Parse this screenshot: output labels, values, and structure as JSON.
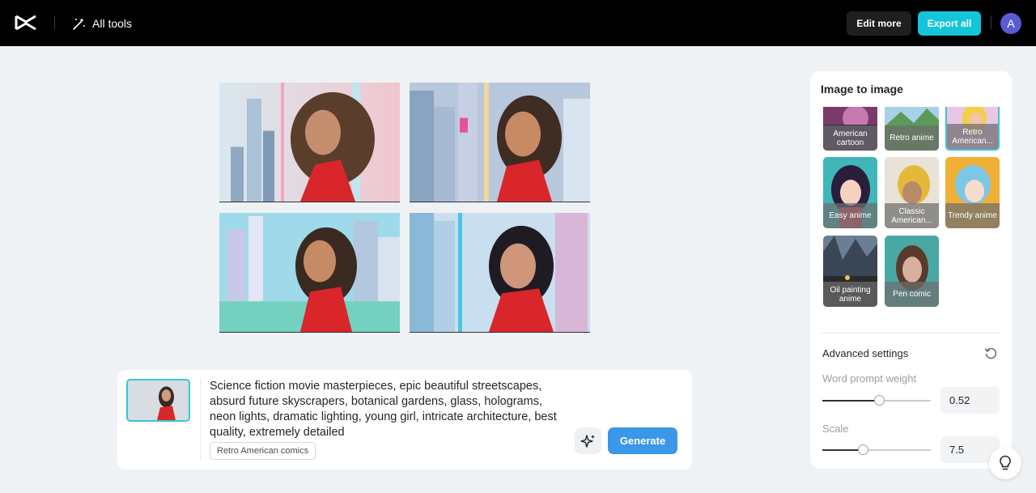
{
  "header": {
    "logo_icon": "capcut-logo-icon",
    "all_tools_label": "All tools",
    "edit_more_label": "Edit more",
    "export_all_label": "Export all",
    "avatar_initial": "A"
  },
  "results": [
    {
      "name": "result-image-1"
    },
    {
      "name": "result-image-2"
    },
    {
      "name": "result-image-3"
    },
    {
      "name": "result-image-4"
    }
  ],
  "prompt": {
    "text": "Science fiction movie masterpieces, epic beautiful streetscapes, absurd future skyscrapers, botanical gardens, glass, holograms, neon lights, dramatic lighting, young girl, intricate architecture, best quality, extremely detailed",
    "style_tag": "Retro American comics",
    "generate_label": "Generate"
  },
  "panel": {
    "title": "Image to image",
    "styles": [
      {
        "label": "American cartoon",
        "selected": false
      },
      {
        "label": "Retro anime",
        "selected": false
      },
      {
        "label": "Retro American...",
        "selected": true
      },
      {
        "label": "Easy anime",
        "selected": false
      },
      {
        "label": "Classic American...",
        "selected": false
      },
      {
        "label": "Trendy anime",
        "selected": false
      },
      {
        "label": "Oil painting anime",
        "selected": false
      },
      {
        "label": "Pen comic",
        "selected": false
      }
    ],
    "advanced_title": "Advanced settings",
    "word_prompt_weight": {
      "label": "Word prompt weight",
      "value": "0.52",
      "fraction": 0.52
    },
    "scale": {
      "label": "Scale",
      "value": "7.5",
      "fraction": 0.37
    }
  },
  "colors": {
    "accent": "#14c4d8",
    "generate": "#3b97e8",
    "selected_border": "#37c6d4"
  }
}
